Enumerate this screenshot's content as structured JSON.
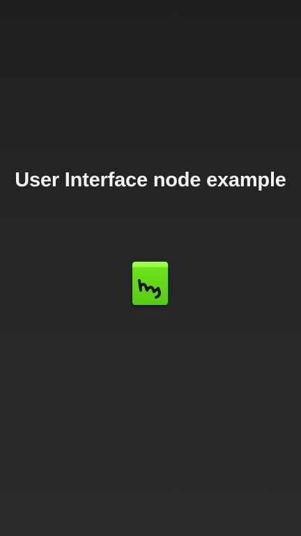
{
  "screen": {
    "title": "User Interface node example"
  },
  "logo": {
    "icon": "hy-cube-logo-icon",
    "colors": {
      "top": "#98ff3f",
      "face": "#62d816",
      "glyph": "#111111"
    }
  }
}
